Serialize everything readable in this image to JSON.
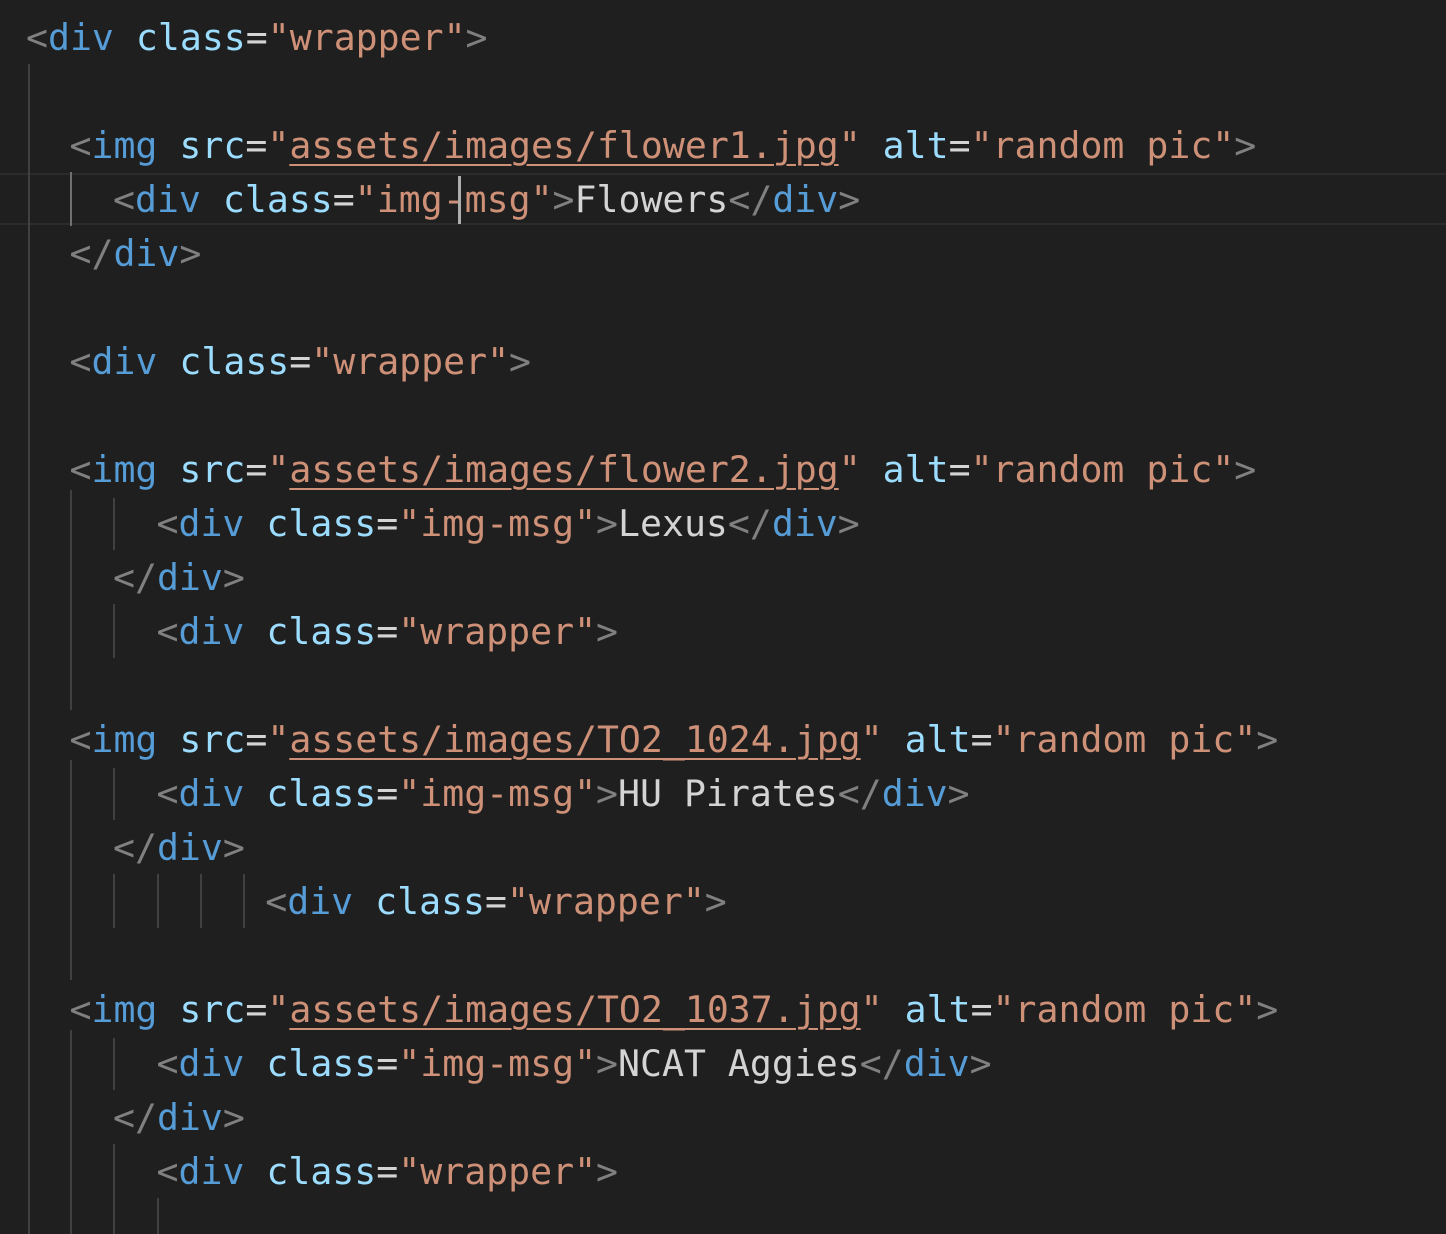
{
  "theme": {
    "background": "#1f1f1f",
    "punctuation": "#808080",
    "tag": "#569cd6",
    "attribute": "#9cdcfe",
    "string": "#ce9178",
    "text": "#d4d4d4"
  },
  "editor": {
    "language": "html",
    "active_line": 3,
    "lines": [
      {
        "indent": 0,
        "tokens": [
          [
            "punc",
            "<"
          ],
          [
            "tag",
            "div"
          ],
          [
            "text",
            " "
          ],
          [
            "attr",
            "class"
          ],
          [
            "eq",
            "="
          ],
          [
            "str",
            "\"wrapper\""
          ],
          [
            "punc",
            ">"
          ]
        ]
      },
      {
        "indent": 0,
        "tokens": []
      },
      {
        "indent": 1,
        "tokens": [
          [
            "punc",
            "<"
          ],
          [
            "tag",
            "img"
          ],
          [
            "text",
            " "
          ],
          [
            "attr",
            "src"
          ],
          [
            "eq",
            "="
          ],
          [
            "str",
            "\""
          ],
          [
            "link",
            "assets/images/flower1.jpg"
          ],
          [
            "str",
            "\""
          ],
          [
            "text",
            " "
          ],
          [
            "attr",
            "alt"
          ],
          [
            "eq",
            "="
          ],
          [
            "str",
            "\"random pic\""
          ],
          [
            "punc",
            ">"
          ]
        ]
      },
      {
        "indent": 2,
        "tokens": [
          [
            "punc",
            "<"
          ],
          [
            "tag",
            "div"
          ],
          [
            "text",
            " "
          ],
          [
            "attr",
            "class"
          ],
          [
            "eq",
            "="
          ],
          [
            "str",
            "\"img-msg\""
          ],
          [
            "punc",
            ">"
          ],
          [
            "text",
            "Flowers"
          ],
          [
            "punc",
            "</"
          ],
          [
            "tag",
            "div"
          ],
          [
            "punc",
            ">"
          ]
        ]
      },
      {
        "indent": 1,
        "tokens": [
          [
            "punc",
            "</"
          ],
          [
            "tag",
            "div"
          ],
          [
            "punc",
            ">"
          ]
        ]
      },
      {
        "indent": 0,
        "tokens": []
      },
      {
        "indent": 1,
        "tokens": [
          [
            "punc",
            "<"
          ],
          [
            "tag",
            "div"
          ],
          [
            "text",
            " "
          ],
          [
            "attr",
            "class"
          ],
          [
            "eq",
            "="
          ],
          [
            "str",
            "\"wrapper\""
          ],
          [
            "punc",
            ">"
          ]
        ]
      },
      {
        "indent": 0,
        "tokens": []
      },
      {
        "indent": 1,
        "tokens": [
          [
            "punc",
            "<"
          ],
          [
            "tag",
            "img"
          ],
          [
            "text",
            " "
          ],
          [
            "attr",
            "src"
          ],
          [
            "eq",
            "="
          ],
          [
            "str",
            "\""
          ],
          [
            "link",
            "assets/images/flower2.jpg"
          ],
          [
            "str",
            "\""
          ],
          [
            "text",
            " "
          ],
          [
            "attr",
            "alt"
          ],
          [
            "eq",
            "="
          ],
          [
            "str",
            "\"random pic\""
          ],
          [
            "punc",
            ">"
          ]
        ]
      },
      {
        "indent": 3,
        "tokens": [
          [
            "punc",
            "<"
          ],
          [
            "tag",
            "div"
          ],
          [
            "text",
            " "
          ],
          [
            "attr",
            "class"
          ],
          [
            "eq",
            "="
          ],
          [
            "str",
            "\"img-msg\""
          ],
          [
            "punc",
            ">"
          ],
          [
            "text",
            "Lexus"
          ],
          [
            "punc",
            "</"
          ],
          [
            "tag",
            "div"
          ],
          [
            "punc",
            ">"
          ]
        ]
      },
      {
        "indent": 2,
        "tokens": [
          [
            "punc",
            "</"
          ],
          [
            "tag",
            "div"
          ],
          [
            "punc",
            ">"
          ]
        ]
      },
      {
        "indent": 3,
        "tokens": [
          [
            "punc",
            "<"
          ],
          [
            "tag",
            "div"
          ],
          [
            "text",
            " "
          ],
          [
            "attr",
            "class"
          ],
          [
            "eq",
            "="
          ],
          [
            "str",
            "\"wrapper\""
          ],
          [
            "punc",
            ">"
          ]
        ]
      },
      {
        "indent": 0,
        "tokens": []
      },
      {
        "indent": 1,
        "tokens": [
          [
            "punc",
            "<"
          ],
          [
            "tag",
            "img"
          ],
          [
            "text",
            " "
          ],
          [
            "attr",
            "src"
          ],
          [
            "eq",
            "="
          ],
          [
            "str",
            "\""
          ],
          [
            "link",
            "assets/images/TO2_1024.jpg"
          ],
          [
            "str",
            "\""
          ],
          [
            "text",
            " "
          ],
          [
            "attr",
            "alt"
          ],
          [
            "eq",
            "="
          ],
          [
            "str",
            "\"random pic\""
          ],
          [
            "punc",
            ">"
          ]
        ]
      },
      {
        "indent": 3,
        "tokens": [
          [
            "punc",
            "<"
          ],
          [
            "tag",
            "div"
          ],
          [
            "text",
            " "
          ],
          [
            "attr",
            "class"
          ],
          [
            "eq",
            "="
          ],
          [
            "str",
            "\"img-msg\""
          ],
          [
            "punc",
            ">"
          ],
          [
            "text",
            "HU Pirates"
          ],
          [
            "punc",
            "</"
          ],
          [
            "tag",
            "div"
          ],
          [
            "punc",
            ">"
          ]
        ]
      },
      {
        "indent": 2,
        "tokens": [
          [
            "punc",
            "</"
          ],
          [
            "tag",
            "div"
          ],
          [
            "punc",
            ">"
          ]
        ]
      },
      {
        "indent": 5.5,
        "tokens": [
          [
            "punc",
            "<"
          ],
          [
            "tag",
            "div"
          ],
          [
            "text",
            " "
          ],
          [
            "attr",
            "class"
          ],
          [
            "eq",
            "="
          ],
          [
            "str",
            "\"wrapper\""
          ],
          [
            "punc",
            ">"
          ]
        ]
      },
      {
        "indent": 0,
        "tokens": []
      },
      {
        "indent": 1,
        "tokens": [
          [
            "punc",
            "<"
          ],
          [
            "tag",
            "img"
          ],
          [
            "text",
            " "
          ],
          [
            "attr",
            "src"
          ],
          [
            "eq",
            "="
          ],
          [
            "str",
            "\""
          ],
          [
            "link",
            "assets/images/TO2_1037.jpg"
          ],
          [
            "str",
            "\""
          ],
          [
            "text",
            " "
          ],
          [
            "attr",
            "alt"
          ],
          [
            "eq",
            "="
          ],
          [
            "str",
            "\"random pic\""
          ],
          [
            "punc",
            ">"
          ]
        ]
      },
      {
        "indent": 3,
        "tokens": [
          [
            "punc",
            "<"
          ],
          [
            "tag",
            "div"
          ],
          [
            "text",
            " "
          ],
          [
            "attr",
            "class"
          ],
          [
            "eq",
            "="
          ],
          [
            "str",
            "\"img-msg\""
          ],
          [
            "punc",
            ">"
          ],
          [
            "text",
            "NCAT Aggies"
          ],
          [
            "punc",
            "</"
          ],
          [
            "tag",
            "div"
          ],
          [
            "punc",
            ">"
          ]
        ]
      },
      {
        "indent": 2,
        "tokens": [
          [
            "punc",
            "</"
          ],
          [
            "tag",
            "div"
          ],
          [
            "punc",
            ">"
          ]
        ]
      },
      {
        "indent": 3,
        "tokens": [
          [
            "punc",
            "<"
          ],
          [
            "tag",
            "div"
          ],
          [
            "text",
            " "
          ],
          [
            "attr",
            "class"
          ],
          [
            "eq",
            "="
          ],
          [
            "str",
            "\"wrapper\""
          ],
          [
            "punc",
            ">"
          ]
        ]
      },
      {
        "indent": 0,
        "tokens": []
      }
    ]
  }
}
